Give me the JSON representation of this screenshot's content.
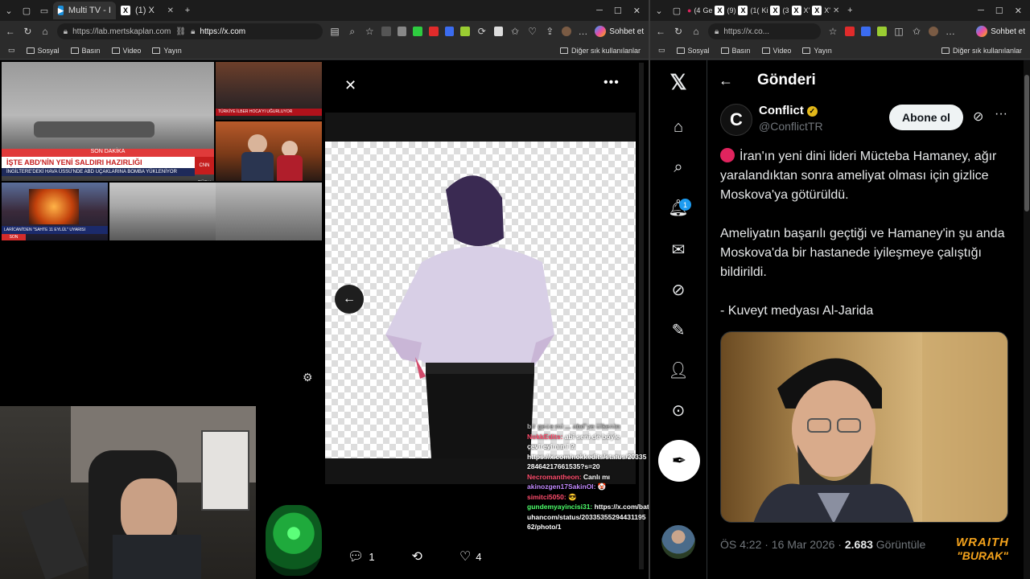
{
  "left_window": {
    "tabs": [
      {
        "label": "Multi TV - I",
        "icon": "tv-icon"
      },
      {
        "label": "(1) X",
        "icon": "x-logo-icon"
      }
    ],
    "url_secondary": "https://lab.mertskaplan.com",
    "url_primary": "https://x.com",
    "chat_button": "Sohbet et",
    "bookmarks": [
      "Sosyal",
      "Basın",
      "Video",
      "Yayın"
    ],
    "bookmarks_right": "Diğer sık kullanılanlar"
  },
  "right_window": {
    "tabs_count_markers": [
      "(4",
      "Ge",
      "(9)",
      "(1(",
      "Ki",
      "(3",
      "X'",
      "X'"
    ],
    "url": "https://x.co...",
    "chat_button": "Sohbet et",
    "bookmarks": [
      "Sosyal",
      "Basın",
      "Video",
      "Yayın"
    ],
    "bookmarks_right": "Diğer sık kullanılanlar"
  },
  "tv": {
    "ticker_1": "SON DAKİKA",
    "headline_1": "İŞTE ABD'NİN YENİ SALDIRI HAZIRLIĞI",
    "sub_1": "İNGİLTERE'DEKİ HAVA ÜSSÜ'NDE ABD UÇAKLARINA BOMBA YÜKLENİYOR",
    "channel_1": "CNN TÜRK",
    "headline_2": "TÜRKİYE İLBER HOCA'YI UĞURLUYOR",
    "headline_3": "LARİCANİ'DEN \"SAHTE 11 EYLÜL\" UYARISI",
    "badge_3": "SON DAKİKA"
  },
  "media_viewer": {
    "actions": {
      "replies": "1",
      "likes": "4"
    }
  },
  "chat": [
    {
      "user": "",
      "text": "bir gece mi ... abd'ye ülkenin"
    },
    {
      "user": "NokkEdits:",
      "text": "abi seni de böyle çevireyim mi ?"
    },
    {
      "user": "",
      "text": "https://x.com/nokkedits/status/2033528464217661535?s=20"
    },
    {
      "user": "Necromantheon:",
      "text": "Canlı mı"
    },
    {
      "user": "akinozgen17SakinOl:",
      "text": "🤡"
    },
    {
      "user": "simitci5050:",
      "text": "😎"
    },
    {
      "user": "gundemyayincisi31:",
      "text": "https://x.com/batuhancom/status/2033535529443119562/photo/1"
    }
  ],
  "x": {
    "header_title": "Gönderi",
    "account_name": "Conflict",
    "account_handle": "@ConflictTR",
    "follow_label": "Abone ol",
    "para_1": "İran'ın yeni dini lideri Mücteba Hamaney, ağır yaralandıktan sonra ameliyat olması için gizlice Moskova'ya götürüldü.",
    "para_2": "Ameliyatın başarılı geçtiği ve Hamaney'in şu anda Moskova'da bir hastanede iyileşmeye çalıştığı bildirildi.",
    "para_3": "- Kuveyt medyası Al-Jarida",
    "meta_time": "ÖS 4:22 · 16 Mar 2026 ·",
    "meta_views": "2.683",
    "meta_views_label": "Görüntüle",
    "notification_count": "1",
    "nav_icons": [
      "x-logo-icon",
      "home-icon",
      "search-icon",
      "bell-icon",
      "mail-icon",
      "grok-icon",
      "lists-icon",
      "profile-icon",
      "more-icon"
    ]
  },
  "overlay_logo": {
    "line1": "WRAITH",
    "line2": "\"BURAK\""
  }
}
